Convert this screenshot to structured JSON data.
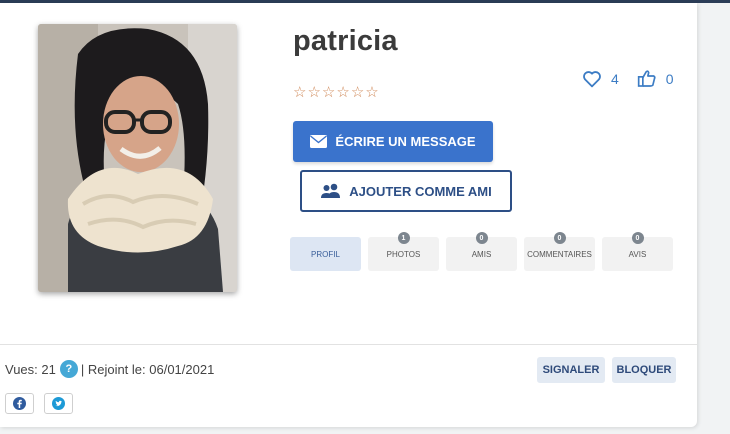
{
  "profile": {
    "username": "patricia",
    "rating_stars": 6,
    "likes": "4",
    "thumbs_up": "0"
  },
  "actions": {
    "message_label": "ÉCRIRE UN MESSAGE",
    "add_friend_label": "AJOUTER COMME AMI"
  },
  "tabs": [
    {
      "label": "PROFIL",
      "badge": ""
    },
    {
      "label": "PHOTOS",
      "badge": "1"
    },
    {
      "label": "AMIS",
      "badge": "0"
    },
    {
      "label": "COMMENTAIRES",
      "badge": "0"
    },
    {
      "label": "AVIS",
      "badge": "0"
    }
  ],
  "footer": {
    "views_label": "Vues: 21",
    "help_icon_text": "?",
    "joined_label": "| Rejoint le: 06/01/2021",
    "report_label": "SIGNALER",
    "block_label": "BLOQUER"
  },
  "share": {
    "facebook_icon": "facebook-icon",
    "twitter_icon": "twitter-icon"
  },
  "colors": {
    "primary": "#3a73cc",
    "outline": "#2d4f86",
    "accent_blue": "#3c7cc4",
    "star": "#d08a5a",
    "help": "#45a8d6"
  }
}
